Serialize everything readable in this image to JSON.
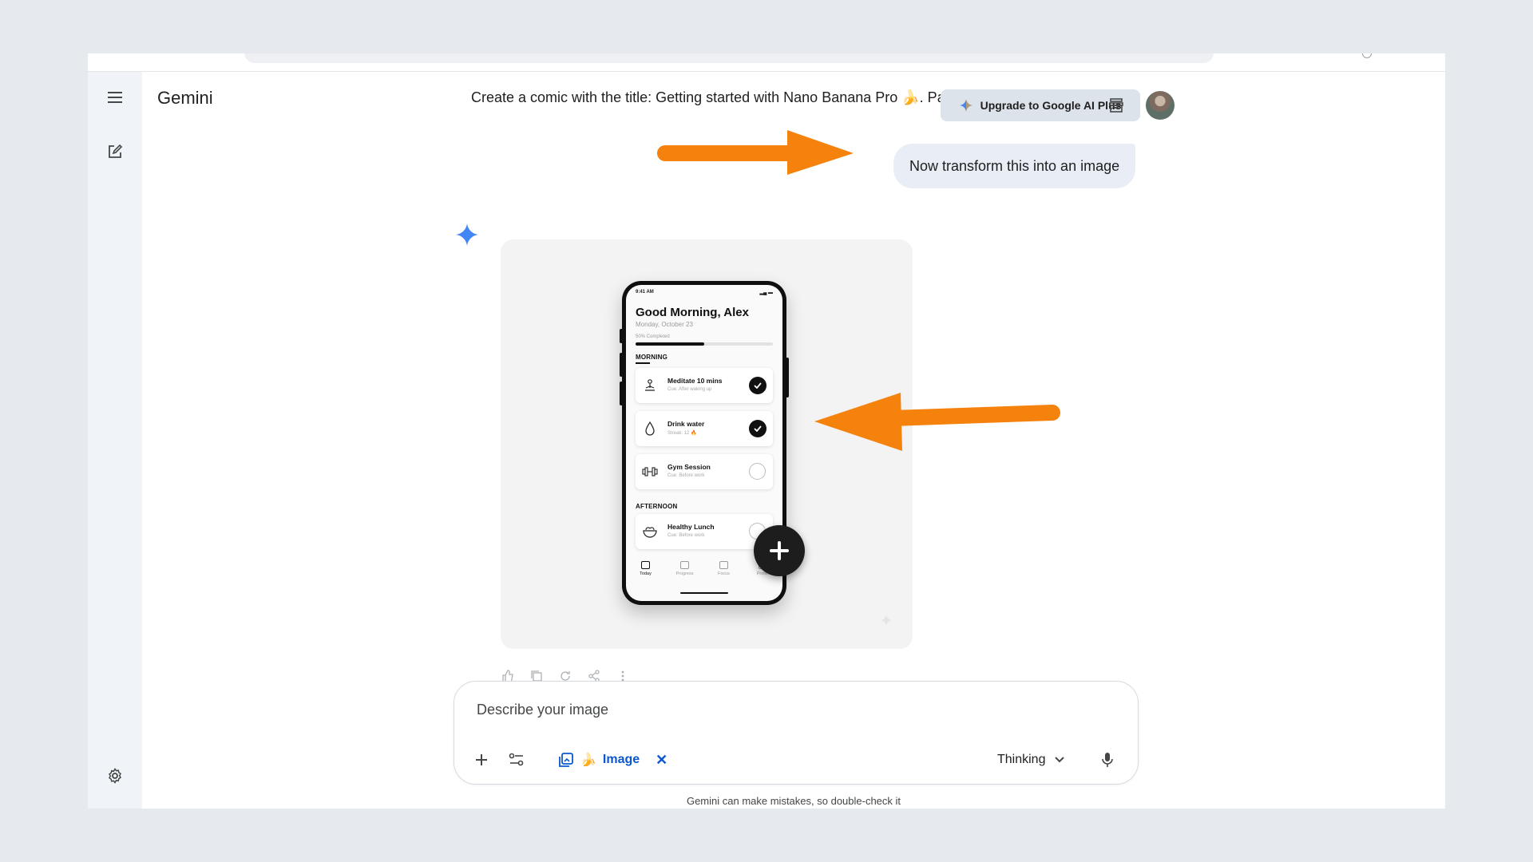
{
  "app": {
    "brand": "Gemini"
  },
  "header": {
    "conversation_title": "Create a comic with the title: Getting started with Nano Banana Pro 🍌. Pan...",
    "upgrade_label": "Upgrade to Google AI Plus"
  },
  "chat": {
    "user_message": "Now transform this into an image"
  },
  "generated_image": {
    "time": "9:41 AM",
    "greeting": "Good Morning, Alex",
    "date": "Monday, October 23",
    "progress_label": "50% Completed",
    "progress_value": 0.5,
    "sections": {
      "morning": "MORNING",
      "afternoon": "AFTERNOON"
    },
    "tasks": [
      {
        "title": "Meditate 10 mins",
        "subtitle": "Cue: After waking up",
        "done": true,
        "icon": "meditation-icon"
      },
      {
        "title": "Drink water",
        "subtitle": "Streak: 12 🔥",
        "done": true,
        "icon": "water-drop-icon"
      },
      {
        "title": "Gym Session",
        "subtitle": "Cue: Before work",
        "done": false,
        "icon": "dumbbell-icon"
      },
      {
        "title": "Healthy Lunch",
        "subtitle": "Cue: Before work",
        "done": false,
        "icon": "salad-bowl-icon"
      }
    ],
    "tabs": [
      "Today",
      "Progress",
      "Focus",
      "Profile"
    ]
  },
  "composer": {
    "placeholder": "Describe your image",
    "tool_chip": "Image",
    "tool_emoji": "🍌",
    "mode": "Thinking"
  },
  "footer": {
    "disclaimer": "Gemini can make mistakes, so double-check it"
  },
  "colors": {
    "page_bg": "#e6e9ee",
    "sidebar_bg": "#f0f4f9",
    "annotation_arrow": "#f5820d",
    "chip_blue": "#0b57d0",
    "sparkle_blue": "#4285f4"
  }
}
